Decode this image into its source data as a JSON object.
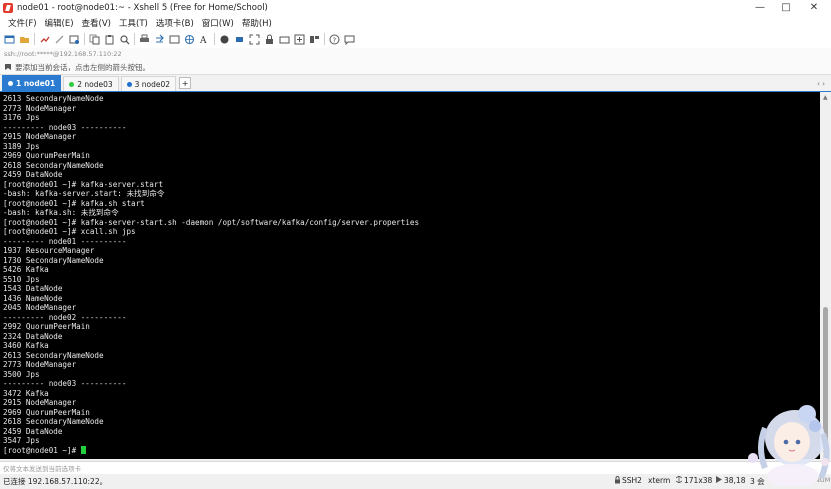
{
  "window": {
    "title": "node01 - root@node01:~ - Xshell 5 (Free for Home/School)",
    "controls": [
      "—",
      "□",
      "✕"
    ]
  },
  "menu": [
    "文件(F)",
    "编辑(E)",
    "查看(V)",
    "工具(T)",
    "选项卡(B)",
    "窗口(W)",
    "帮助(H)"
  ],
  "address": {
    "text": "ssh://root:*****@192.168.57.110:22"
  },
  "hint": {
    "text": "要添加当前会话，点击左侧的箭头按钮。"
  },
  "tabs": [
    {
      "label": "1 node01",
      "active": true,
      "dot_color": "#2ecc40"
    },
    {
      "label": "2 node03",
      "active": false,
      "dot_color": "#2ecc40"
    },
    {
      "label": "3 node02",
      "active": false,
      "dot_color": "#1f6fd1"
    }
  ],
  "tab_add": "+",
  "tab_nav": "‹ ›",
  "terminal": {
    "lines": [
      "2613 SecondaryNameNode",
      "2773 NodeManager",
      "3176 Jps",
      "--------- node03 ----------",
      "2915 NodeManager",
      "3189 Jps",
      "2969 QuorumPeerMain",
      "2618 SecondaryNameNode",
      "2459 DataNode",
      "[root@node01 ~]# kafka-server.start",
      "-bash: kafka-server.start: 未找到命令",
      "[root@node01 ~]# kafka.sh start",
      "-bash: kafka.sh: 未找到命令",
      "[root@node01 ~]# kafka-server-start.sh -daemon /opt/software/kafka/config/server.properties",
      "[root@node01 ~]# xcall.sh jps",
      "--------- node01 ----------",
      "1937 ResourceManager",
      "1730 SecondaryNameNode",
      "5426 Kafka",
      "5510 Jps",
      "1543 DataNode",
      "1436 NameNode",
      "2045 NodeManager",
      "--------- node02 ----------",
      "2992 QuorumPeerMain",
      "2324 DataNode",
      "3460 Kafka",
      "2613 SecondaryNameNode",
      "2773 NodeManager",
      "3500 Jps",
      "--------- node03 ----------",
      "3472 Kafka",
      "2915 NodeManager",
      "2969 QuorumPeerMain",
      "2618 SecondaryNameNode",
      "2459 DataNode",
      "3547 Jps"
    ],
    "prompt": "[root@node01 ~]# ",
    "cursor_color": "#23d03c"
  },
  "compose": {
    "text": "仅将文本发送到当前选项卡"
  },
  "status": {
    "connection": "已连接 192.168.57.110:22。",
    "protocol": "SSH2",
    "terminal_type": "xterm",
    "size": "171x38",
    "position": "38,18",
    "sessions": "3 会",
    "num": "NUM"
  }
}
